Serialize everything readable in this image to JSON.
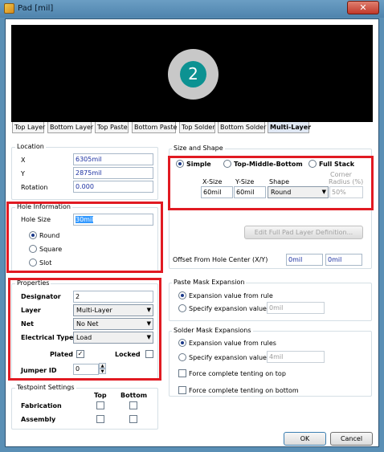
{
  "window": {
    "title": "Pad [mil]",
    "close_glyph": "✕"
  },
  "preview": {
    "pad_number": "2"
  },
  "layer_tabs": [
    "Top Layer",
    "Bottom Layer",
    "Top Paste",
    "Bottom Paste",
    "Top Solder",
    "Bottom Solder",
    "Multi-Layer"
  ],
  "location": {
    "title": "Location",
    "x_label": "X",
    "x_value": "6305mil",
    "y_label": "Y",
    "y_value": "2875mil",
    "rotation_label": "Rotation",
    "rotation_value": "0.000"
  },
  "hole": {
    "title": "Hole Information",
    "size_label": "Hole Size",
    "size_value": "30mil",
    "round": "Round",
    "square": "Square",
    "slot": "Slot"
  },
  "properties": {
    "title": "Properties",
    "designator_label": "Designator",
    "designator_value": "2",
    "layer_label": "Layer",
    "layer_value": "Multi-Layer",
    "net_label": "Net",
    "net_value": "No Net",
    "etype_label": "Electrical Type",
    "etype_value": "Load",
    "plated_label": "Plated",
    "locked_label": "Locked",
    "jumper_label": "Jumper ID",
    "jumper_value": "0"
  },
  "testpoint": {
    "title": "Testpoint Settings",
    "top": "Top",
    "bottom": "Bottom",
    "fabrication": "Fabrication",
    "assembly": "Assembly"
  },
  "size_shape": {
    "title": "Size and Shape",
    "simple": "Simple",
    "tmb": "Top-Middle-Bottom",
    "full": "Full Stack",
    "xsize_label": "X-Size",
    "ysize_label": "Y-Size",
    "shape_label": "Shape",
    "corner_label_1": "Corner",
    "corner_label_2": "Radius (%)",
    "xsize_value": "60mil",
    "ysize_value": "60mil",
    "shape_value": "Round",
    "corner_value": "50%",
    "edit_full": "Edit Full Pad Layer Definition...",
    "offset_label": "Offset From Hole Center (X/Y)",
    "offset_x": "0mil",
    "offset_y": "0mil"
  },
  "paste": {
    "title": "Paste Mask Expansion",
    "from_rule": "Expansion value from rule",
    "specify": "Specify expansion value",
    "value": "0mil"
  },
  "solder": {
    "title": "Solder Mask Expansions",
    "from_rules": "Expansion value from rules",
    "specify": "Specify expansion value",
    "value": "4mil",
    "tent_top": "Force complete tenting on top",
    "tent_bottom": "Force complete tenting on bottom"
  },
  "buttons": {
    "ok": "OK",
    "cancel": "Cancel"
  },
  "glyphs": {
    "check": "✓",
    "down_arrow": "▼",
    "up_small": "▲",
    "down_small": "▼"
  },
  "accent_colors": {
    "pad_hole": "#0c9292",
    "highlight_box": "#e11a22",
    "value_text": "#1a2fa0"
  }
}
